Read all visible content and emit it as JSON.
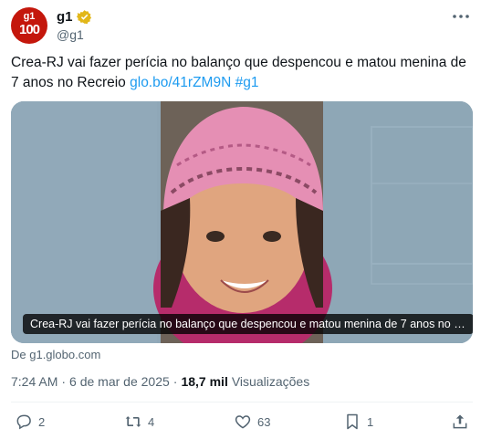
{
  "header": {
    "avatar_text_top": "g1",
    "avatar_text_bottom": "100",
    "display_name": "g1",
    "handle": "@g1"
  },
  "tweet": {
    "text": "Crea-RJ vai fazer perícia no balanço que despencou e matou menina de 7 anos no Recreio",
    "link": "glo.bo/41rZM9N",
    "hashtag": "#g1"
  },
  "media": {
    "caption": "Crea-RJ vai fazer perícia no balanço que despencou e matou menina de 7 anos no Rec..."
  },
  "source": "De g1.globo.com",
  "meta": {
    "time": "7:24 AM",
    "separator": "·",
    "date": "6 de mar de 2025",
    "views_count": "18,7 mil",
    "views_label": "Visualizações"
  },
  "actions": {
    "replies": "2",
    "reposts": "4",
    "likes": "63",
    "bookmarks": "1"
  },
  "colors": {
    "brand": "#c4170c",
    "link": "#1d9bf0",
    "muted": "#536471"
  }
}
